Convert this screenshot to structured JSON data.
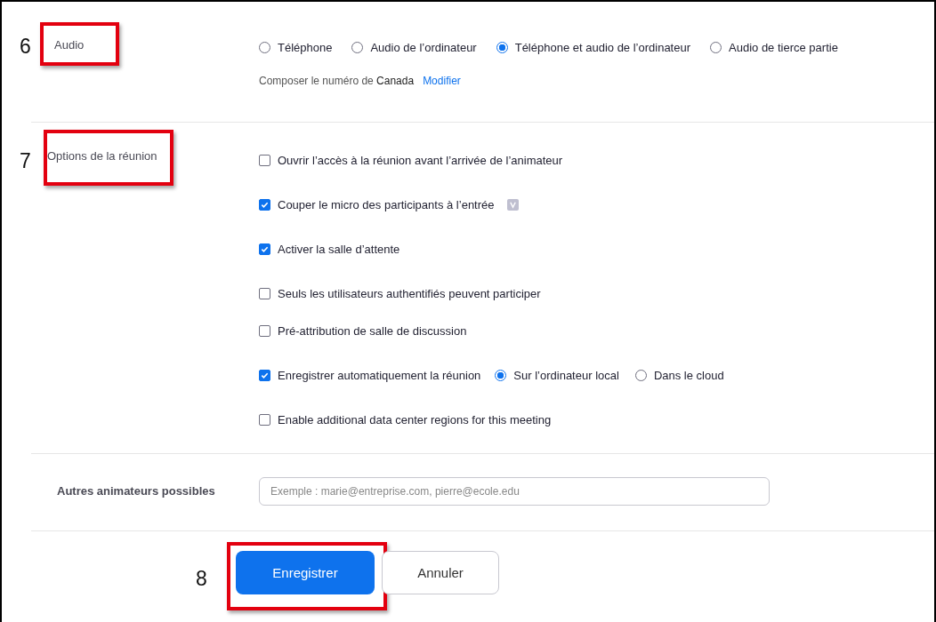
{
  "audio": {
    "step": "6",
    "label": "Audio",
    "highlighted": true,
    "options": [
      {
        "label": "Téléphone",
        "selected": false
      },
      {
        "label": "Audio de l’ordinateur",
        "selected": false
      },
      {
        "label": "Téléphone et audio de l’ordinateur",
        "selected": true
      },
      {
        "label": "Audio de tierce partie",
        "selected": false
      }
    ],
    "dial_prefix": "Composer le numéro de",
    "dial_country": "Canada",
    "dial_link": "Modifier"
  },
  "meeting_options": {
    "step": "7",
    "label": "Options de la réunion",
    "highlighted": true,
    "items": [
      {
        "kind": "checkbox",
        "label": "Ouvrir l’accès à la réunion avant l’arrivée de l’animateur",
        "checked": false
      },
      {
        "kind": "checkbox",
        "label": "Couper le micro des participants à l’entrée",
        "checked": true,
        "badge": true
      },
      {
        "kind": "checkbox",
        "label": "Activer la salle d’attente",
        "checked": true
      },
      {
        "kind": "checkbox",
        "label": "Seuls les utilisateurs authentifiés peuvent participer",
        "checked": false
      },
      {
        "kind": "checkbox",
        "label": "Pré-attribution de salle de discussion",
        "checked": false
      },
      {
        "kind": "checkbox-radios",
        "label": "Enregistrer automatiquement la réunion",
        "checked": true,
        "choices": [
          {
            "label": "Sur l’ordinateur local",
            "selected": true
          },
          {
            "label": "Dans le cloud",
            "selected": false
          }
        ]
      },
      {
        "kind": "checkbox",
        "label": "Enable additional data center regions for this meeting",
        "checked": false
      }
    ]
  },
  "alternative_hosts": {
    "label": "Autres animateurs possibles",
    "placeholder": "Exemple : marie@entreprise.com, pierre@ecole.edu"
  },
  "actions": {
    "step": "8",
    "highlighted": true,
    "buttons": [
      {
        "kind": "primary",
        "label": "Enregistrer"
      },
      {
        "kind": "secondary",
        "label": "Annuler"
      }
    ]
  }
}
